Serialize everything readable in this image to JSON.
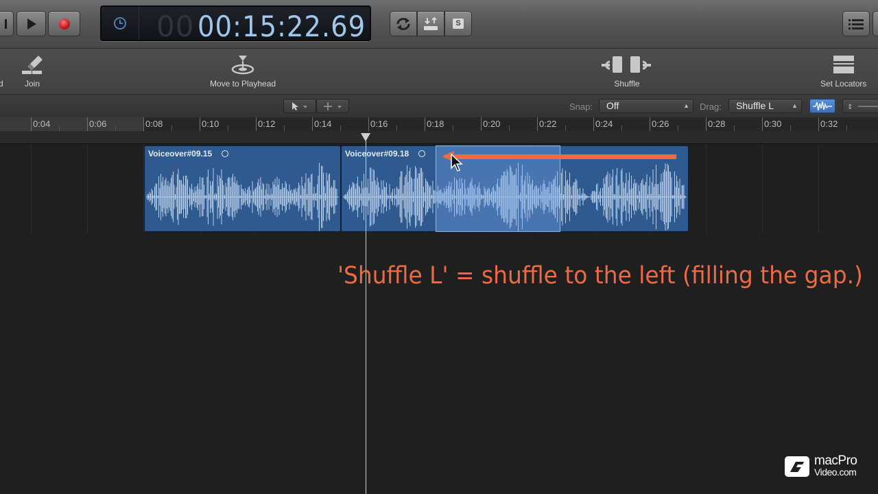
{
  "transport": {
    "time_dim": "00",
    "time": "00:15:22.69",
    "icons": [
      "rewind-end-icon",
      "play-icon",
      "record-icon",
      "clock-icon",
      "cycle-icon",
      "replace-icon",
      "solo-icon",
      "list-view-icon"
    ],
    "solo_letter": "S"
  },
  "toolbar": {
    "partial_left": "d",
    "join": "Join",
    "move_to_playhead": "Move to Playhead",
    "shuffle": "Shuffle",
    "set_locators": "Set Locators"
  },
  "snapbar": {
    "snap_label": "Snap:",
    "snap_value": "Off",
    "drag_label": "Drag:",
    "drag_value": "Shuffle L"
  },
  "ruler": {
    "labels": [
      "0:04",
      "0:06",
      "0:08",
      "0:10",
      "0:12",
      "0:14",
      "0:16",
      "0:18",
      "0:20",
      "0:22",
      "0:24",
      "0:26",
      "0:28",
      "0:30",
      "0:32"
    ]
  },
  "regions": [
    {
      "name": "Voiceover#09.15"
    },
    {
      "name": "Voiceover#09.18"
    }
  ],
  "annotation": "'Shuffle L' = shuffle to the left (filling the gap.)",
  "colors": {
    "region": "#2f5a8f",
    "annotation": "#ec6b45",
    "lcd_text": "#9fc7ee"
  },
  "watermark": {
    "line1": "macPro",
    "line2": "Video.com"
  }
}
